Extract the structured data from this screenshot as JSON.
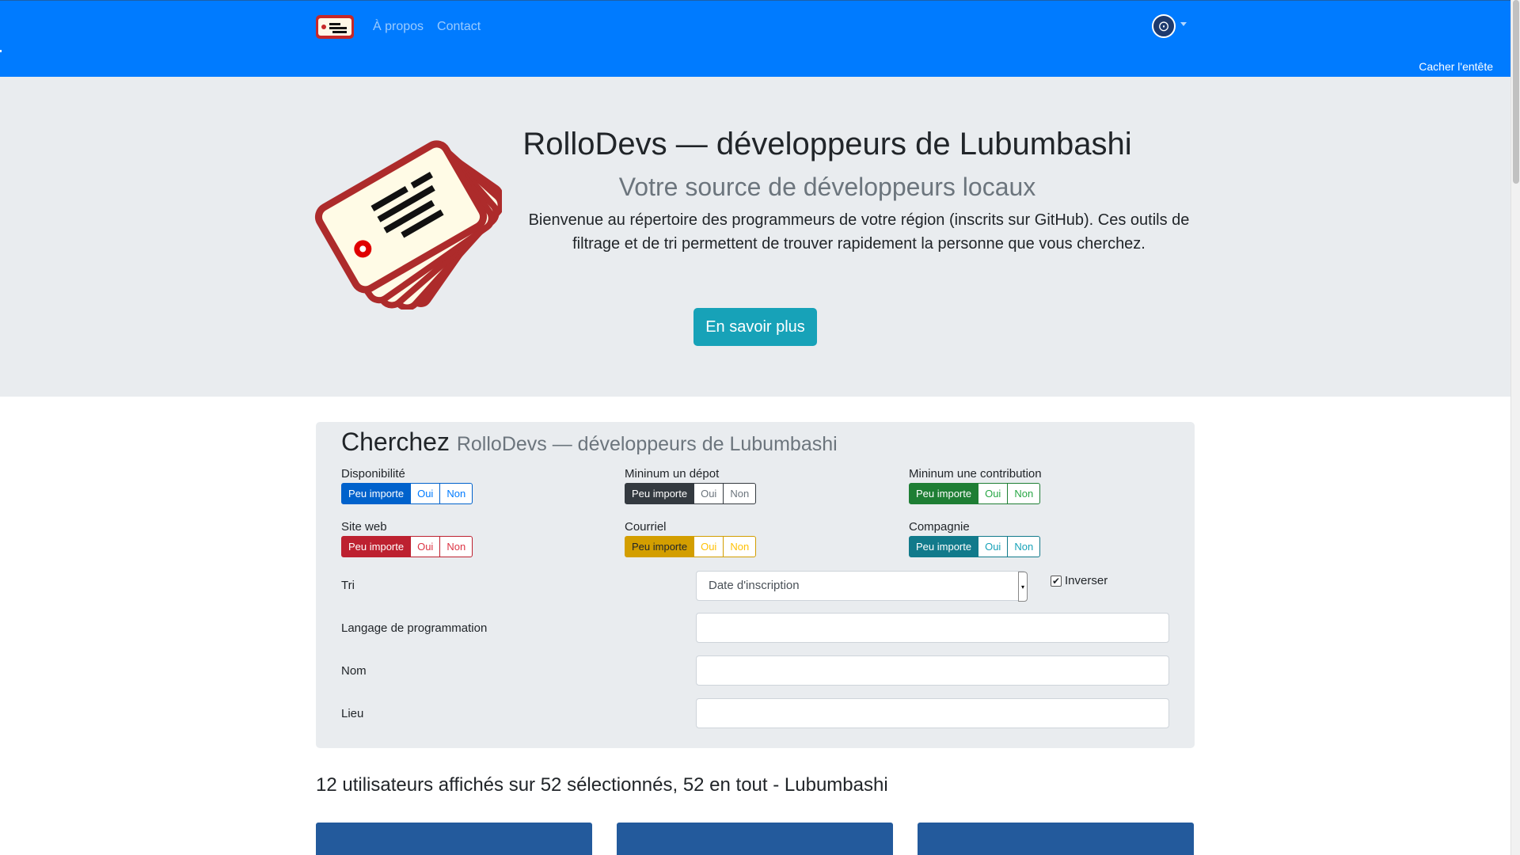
{
  "navbar": {
    "brand_icon": "id-card-logo-icon",
    "links": [
      "À propos",
      "Contact"
    ],
    "language_icon": "globe-icon",
    "hide_header": "Cacher l'entête",
    "color": "#007bff"
  },
  "hero": {
    "title": "RolloDevs — développeurs de Lubumbashi",
    "subtitle": "Votre source de développeurs locaux",
    "lead": "Bienvenue au répertoire des programmeurs de votre région (inscrits sur GitHub). Ces outils de filtrage et de tri permettent de trouver rapidement la personne que vous cherchez.",
    "button": "En savoir plus",
    "illustration": "id-cards-stack-icon"
  },
  "search": {
    "title": "Cherchez",
    "title_small": "RolloDevs — développeurs de Lubumbashi",
    "filters": [
      {
        "label": "Disponibilité",
        "options": [
          "Peu importe",
          "Oui",
          "Non"
        ],
        "selected": "Peu importe",
        "color": "#0062cc"
      },
      {
        "label": "Mininum un dépot",
        "options": [
          "Peu importe",
          "Oui",
          "Non"
        ],
        "selected": "Peu importe",
        "color": "#343a40"
      },
      {
        "label": "Mininum une contribution",
        "options": [
          "Peu importe",
          "Oui",
          "Non"
        ],
        "selected": "Peu importe",
        "color": "#1e7e34"
      },
      {
        "label": "Site web",
        "options": [
          "Peu importe",
          "Oui",
          "Non"
        ],
        "selected": "Peu importe",
        "color": "#bd2130"
      },
      {
        "label": "Courriel",
        "options": [
          "Peu importe",
          "Oui",
          "Non"
        ],
        "selected": "Peu importe",
        "color": "#d39e00"
      },
      {
        "label": "Compagnie",
        "options": [
          "Peu importe",
          "Oui",
          "Non"
        ],
        "selected": "Peu importe",
        "color": "#117a8b"
      }
    ],
    "sort_label": "Tri",
    "sort_value": "Date d'inscription",
    "invert_label": "Inverser",
    "invert_checked": true,
    "language_label": "Langage de programmation",
    "language_value": "",
    "name_label": "Nom",
    "name_value": "",
    "location_label": "Lieu",
    "location_value": ""
  },
  "results": {
    "summary": "12 utilisateurs affichés sur 52 sélectionnés, 52 en tout - Lubumbashi"
  }
}
